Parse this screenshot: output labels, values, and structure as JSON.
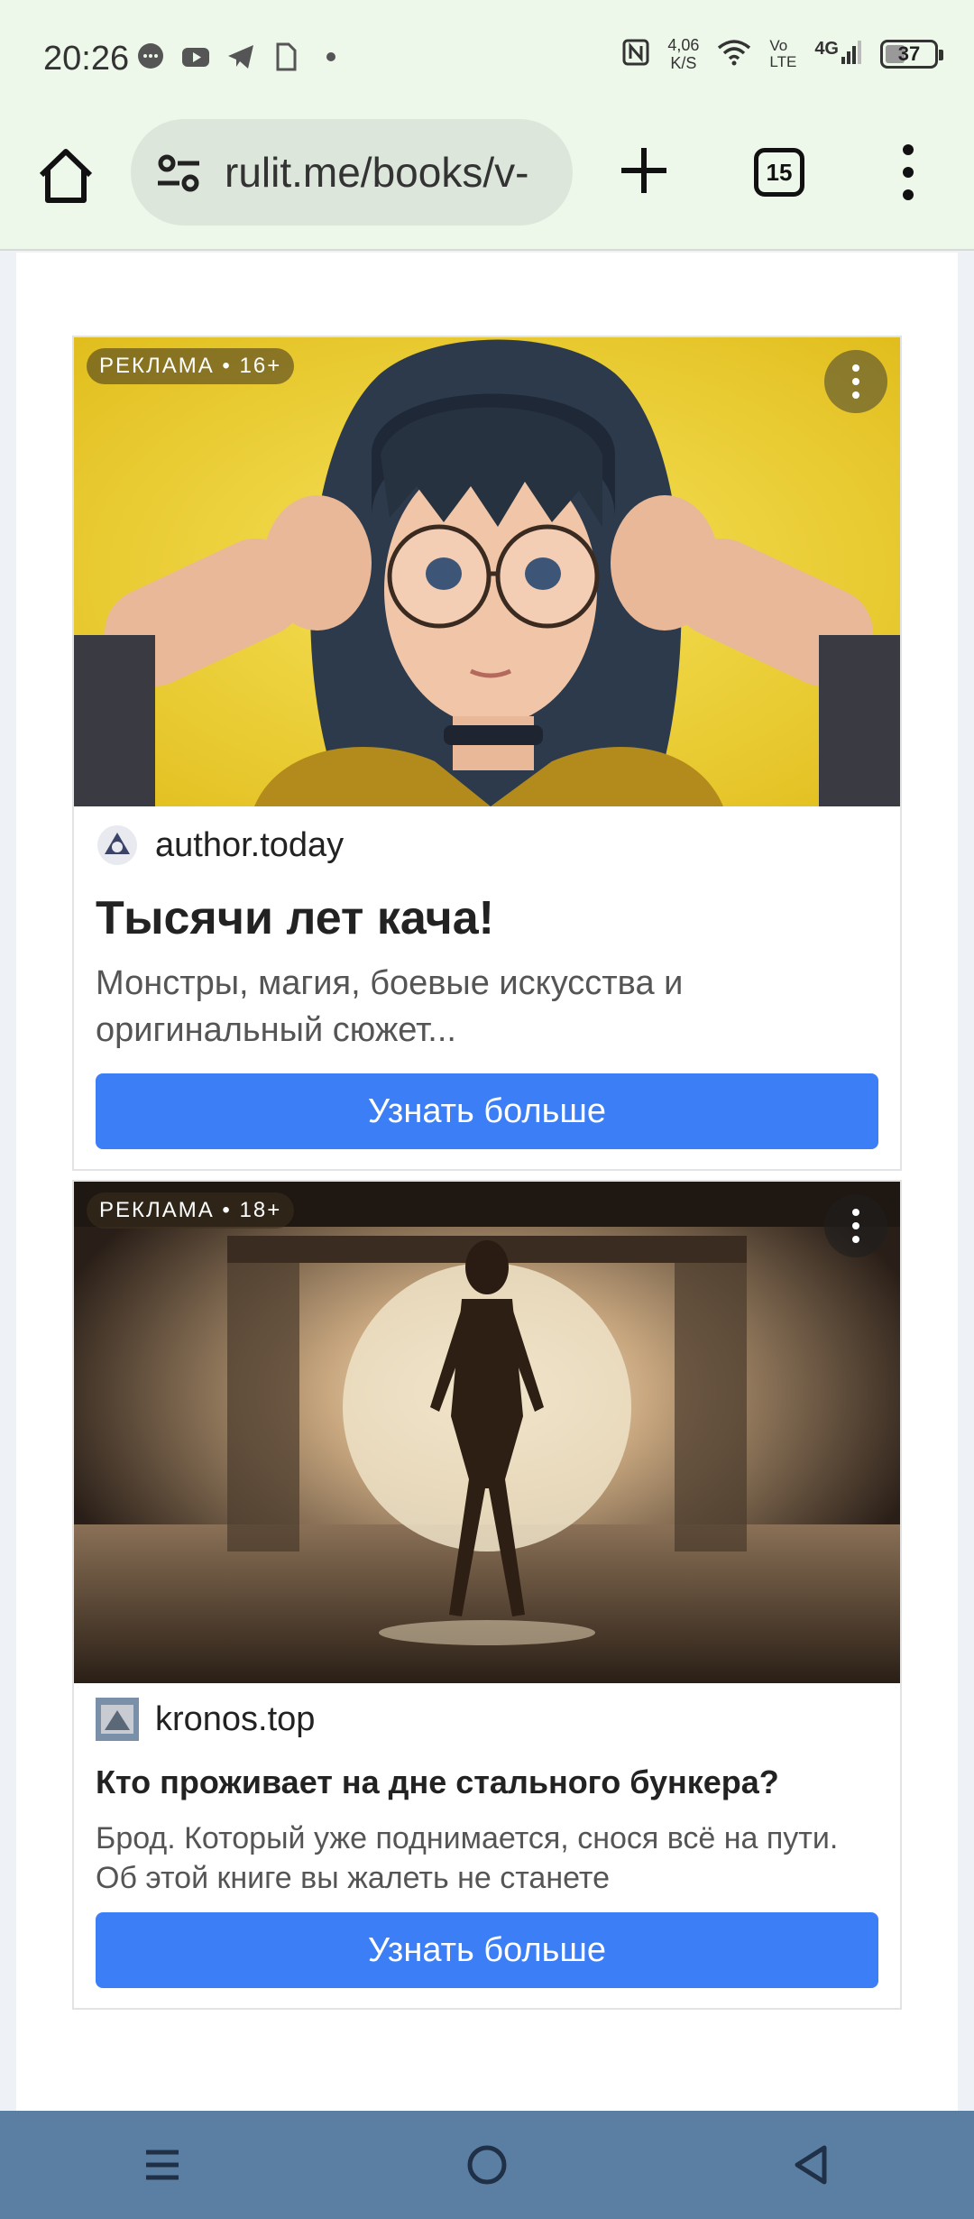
{
  "status_bar": {
    "time": "20:26",
    "net_speed_value": "4,06",
    "net_speed_unit": "K/S",
    "volte_top": "Vo",
    "volte_bottom": "LTE",
    "network": "4G",
    "battery": "37"
  },
  "browser": {
    "url": "rulit.me/books/v-",
    "tab_count": "15"
  },
  "ads": [
    {
      "label": "РЕКЛАМА • 16+",
      "source": "author.today",
      "title": "Тысячи лет кача!",
      "description": "Монстры, магия, боевые искусства и оригинальный сюжет...",
      "button": "Узнать больше"
    },
    {
      "label": "РЕКЛАМА • 18+",
      "source": "kronos.top",
      "title": "Кто проживает на дне стального бункера?",
      "description": "Брод. Который уже поднимается, снося всё на пути. Об этой книге вы жалеть не станете",
      "button": "Узнать больше"
    }
  ],
  "colors": {
    "accent_button": "#3c7ef6",
    "toolbar_bg": "#eef8ea",
    "navbar_bg": "#5b7fa3",
    "scroll_top_bg": "#6fcdb3"
  },
  "icons": {
    "home": "home-icon",
    "site_settings": "tune-icon",
    "new_tab": "plus-icon",
    "menu": "kebab-menu-icon",
    "scroll_top": "chevron-up-icon"
  }
}
